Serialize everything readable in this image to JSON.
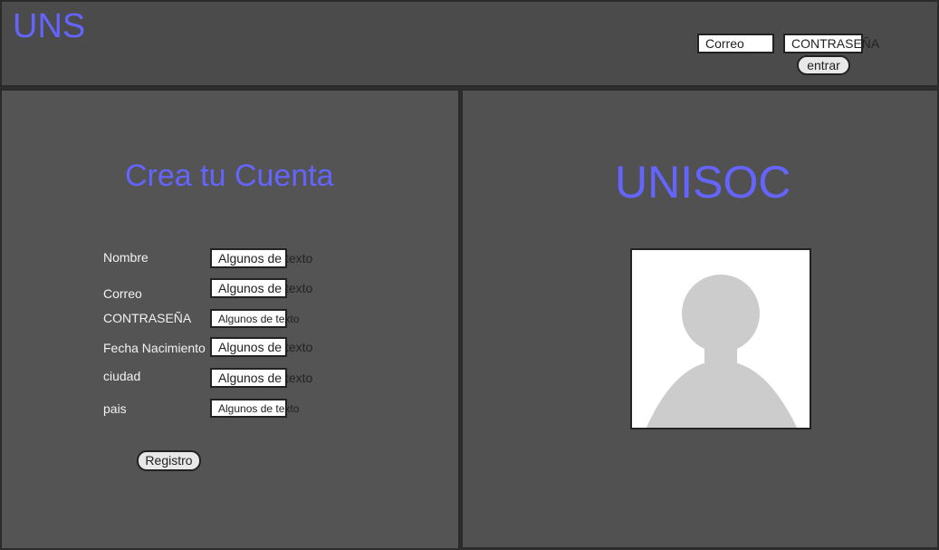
{
  "header": {
    "logo": "UNS",
    "email_value": "Correo",
    "password_value": "CONTRASEÑA",
    "login_label": "entrar"
  },
  "register": {
    "title": "Crea tu Cuenta",
    "fields": [
      {
        "label": "Nombre",
        "value": "Algunos de texto"
      },
      {
        "label": "Correo",
        "value": "Algunos de texto"
      },
      {
        "label": "CONTRASEÑA",
        "value": "Algunos de texto"
      },
      {
        "label": "Fecha Nacimiento",
        "value": "Algunos de texto"
      },
      {
        "label": "ciudad",
        "value": "Algunos de texto"
      },
      {
        "label": "pais",
        "value": "Algunos de texto"
      }
    ],
    "submit_label": "Registro"
  },
  "brand": {
    "title": "UNISOC"
  },
  "colors": {
    "accent": "#6464ff",
    "panel": "#545454"
  }
}
